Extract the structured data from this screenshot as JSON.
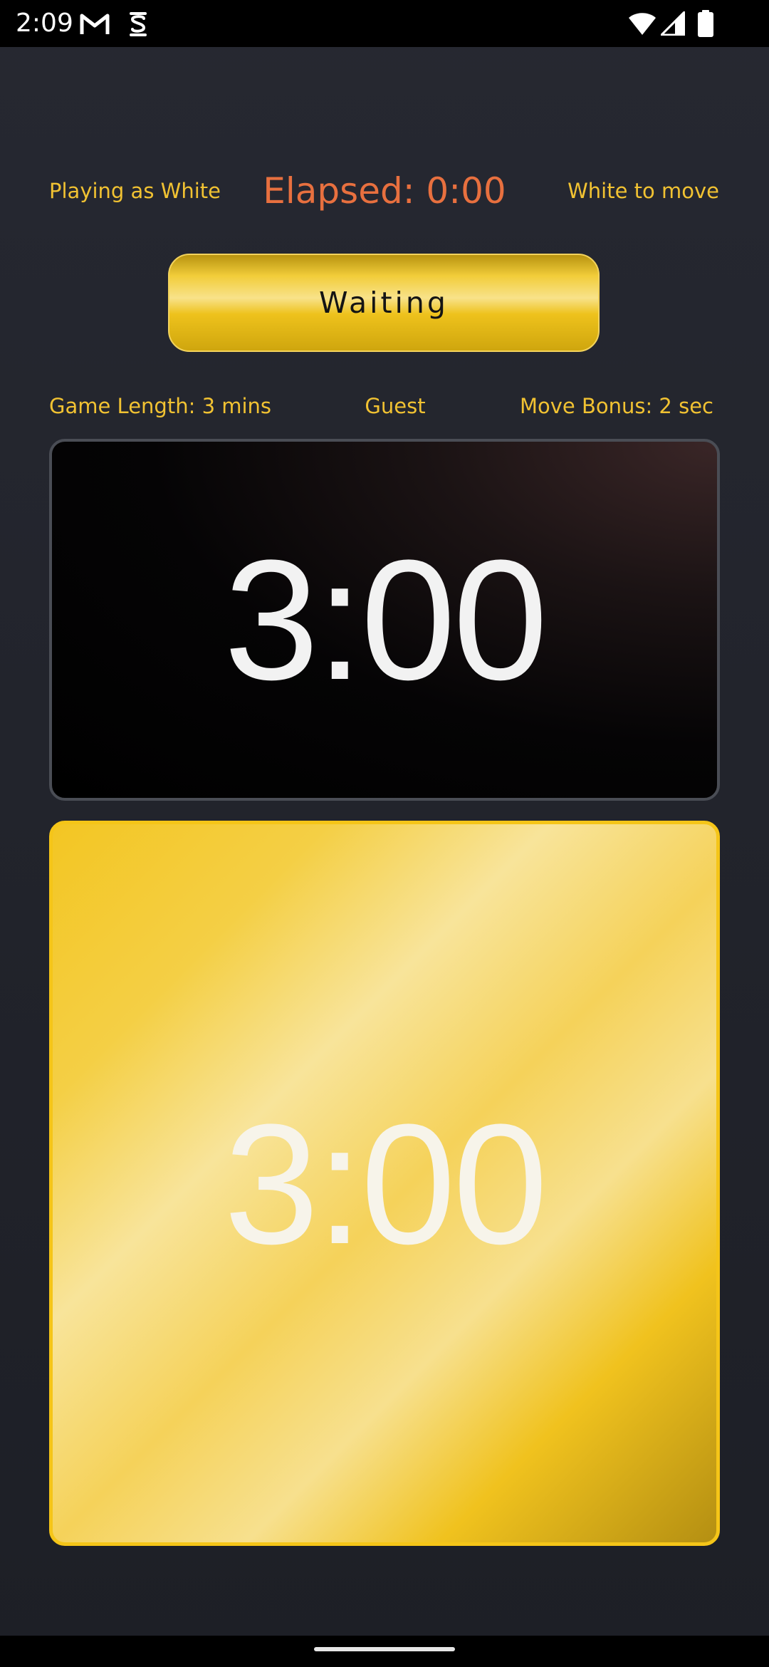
{
  "status_bar": {
    "time": "2:09",
    "left_icons": [
      "gmail-icon",
      "app-notification-icon"
    ],
    "right_icons": [
      "wifi-icon",
      "cell-signal-icon",
      "battery-icon"
    ]
  },
  "header": {
    "playing_as": "Playing as White",
    "elapsed": "Elapsed: 0:00",
    "turn": "White to move"
  },
  "action_button": {
    "label": "Waiting"
  },
  "game_info": {
    "game_length": "Game Length: 3 mins",
    "player": "Guest",
    "move_bonus": "Move Bonus: 2 sec"
  },
  "clocks": {
    "black_time": "3:00",
    "white_time": "3:00"
  },
  "colors": {
    "accent_gold": "#f1c232",
    "elapsed_orange": "#e8703f",
    "background": "#24262e"
  }
}
